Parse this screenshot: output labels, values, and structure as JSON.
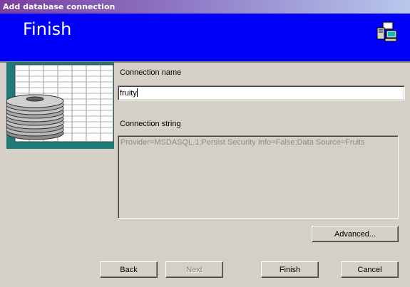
{
  "window": {
    "title": "Add database connection"
  },
  "banner": {
    "title": "Finish",
    "icon": "network-computers-icon"
  },
  "side_image": {
    "icon": "database-disks-icon"
  },
  "form": {
    "connection_name_label": "Connection name",
    "connection_name_value": "fruity",
    "connection_string_label": "Connection string",
    "connection_string_value": "Provider=MSDASQL.1;Persist Security Info=False;Data Source=Fruits"
  },
  "buttons": {
    "advanced": "Advanced...",
    "back": "Back",
    "next": "Next",
    "finish": "Finish",
    "cancel": "Cancel"
  },
  "colors": {
    "banner": "#0000f8",
    "dialog": "#d4d0c8",
    "side_panel": "#1f7a7a"
  }
}
